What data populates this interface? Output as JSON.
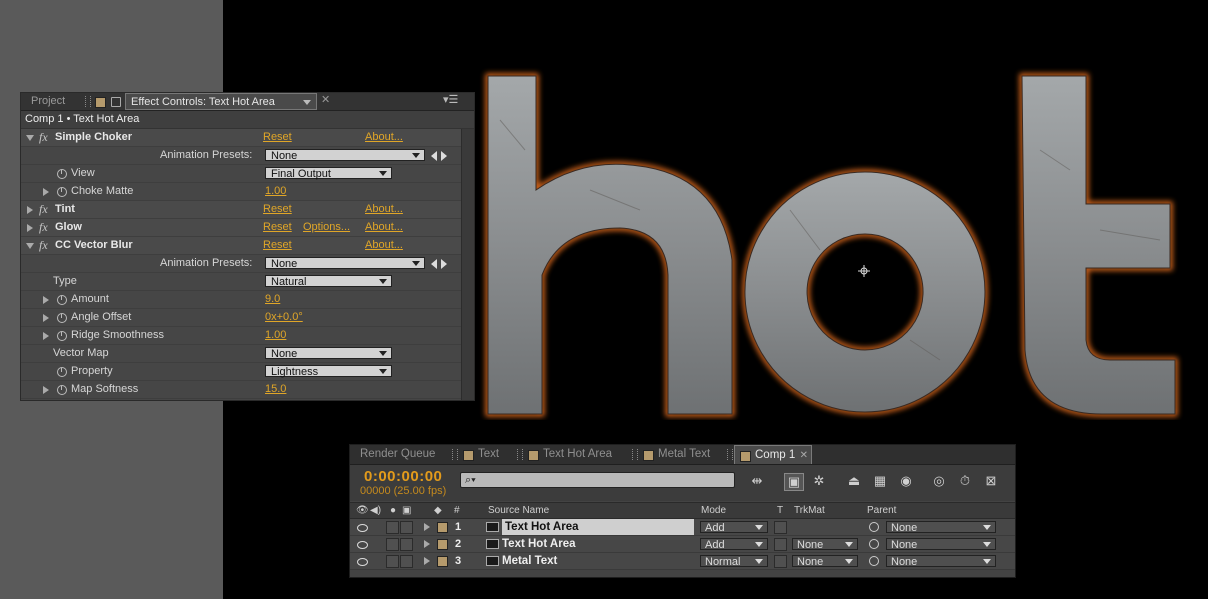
{
  "effect_controls": {
    "tabs": {
      "project": "Project",
      "effect_controls": "Effect Controls: Text Hot Area"
    },
    "header": "Comp 1 • Text Hot Area",
    "rows": {
      "simple_choker": {
        "fx": "fx",
        "name": "Simple Choker",
        "reset": "Reset",
        "about": "About..."
      },
      "sc_presets": {
        "label": "Animation Presets:",
        "value": "None"
      },
      "sc_view": {
        "label": "View",
        "value": "Final Output"
      },
      "sc_choke": {
        "label": "Choke Matte",
        "value": "1.00"
      },
      "tint": {
        "fx": "fx",
        "name": "Tint",
        "reset": "Reset",
        "about": "About..."
      },
      "glow": {
        "fx": "fx",
        "name": "Glow",
        "reset": "Reset",
        "options": "Options...",
        "about": "About..."
      },
      "cc_vector_blur": {
        "fx": "fx",
        "name": "CC Vector Blur",
        "reset": "Reset",
        "about": "About..."
      },
      "vb_presets": {
        "label": "Animation Presets:",
        "value": "None"
      },
      "vb_type": {
        "label": "Type",
        "value": "Natural"
      },
      "vb_amount": {
        "label": "Amount",
        "value": "9.0"
      },
      "vb_angle": {
        "label": "Angle Offset",
        "value": "0x+0.0°"
      },
      "vb_ridge": {
        "label": "Ridge Smoothness",
        "value": "1.00"
      },
      "vb_vmap": {
        "label": "Vector Map",
        "value": "None"
      },
      "vb_property": {
        "label": "Property",
        "value": "Lightness"
      },
      "vb_softness": {
        "label": "Map Softness",
        "value": "15.0"
      }
    }
  },
  "timeline": {
    "tabs": [
      "Render Queue",
      "Text",
      "Text Hot Area",
      "Metal Text",
      "Comp 1"
    ],
    "timecode": "0:00:00:00",
    "frames": "00000 (25.00 fps)",
    "columns": {
      "num": "#",
      "source": "Source Name",
      "mode": "Mode",
      "t": "T",
      "trkmat": "TrkMat",
      "parent": "Parent"
    },
    "layers": [
      {
        "num": "1",
        "name": "Text Hot Area",
        "mode": "Add",
        "trkmat": "",
        "parent": "None"
      },
      {
        "num": "2",
        "name": "Text Hot Area",
        "mode": "Add",
        "trkmat": "None",
        "parent": "None"
      },
      {
        "num": "3",
        "name": "Metal Text",
        "mode": "Normal",
        "trkmat": "None",
        "parent": "None"
      }
    ]
  },
  "composition": {
    "text": "hot",
    "colors": {
      "metal": "#8a8e90",
      "glow": "#ff6a1a",
      "accent": "#e0a628"
    }
  }
}
